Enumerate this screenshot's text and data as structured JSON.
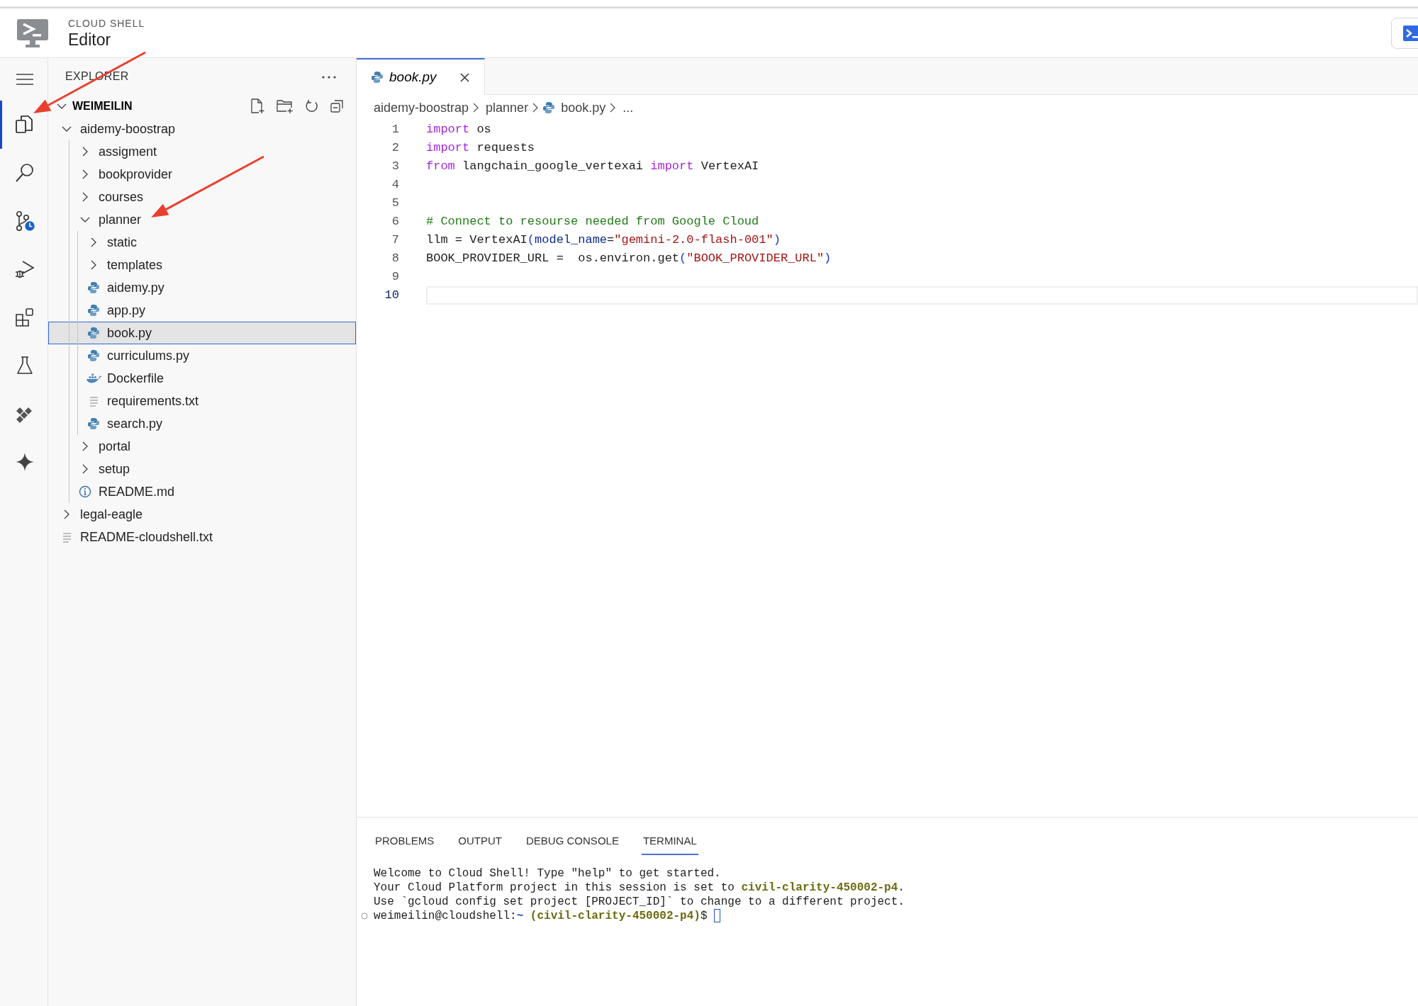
{
  "header": {
    "product": "CLOUD SHELL",
    "title": "Editor"
  },
  "activity_bar": [
    {
      "kind": "files",
      "selected": true
    },
    {
      "kind": "search",
      "selected": false
    },
    {
      "kind": "source-control",
      "selected": false
    },
    {
      "kind": "run-debug",
      "selected": false
    },
    {
      "kind": "extensions",
      "selected": false
    },
    {
      "kind": "testing",
      "selected": false
    },
    {
      "kind": "cloud-code",
      "selected": false
    },
    {
      "kind": "gemini",
      "selected": false
    }
  ],
  "explorer": {
    "title": "EXPLORER",
    "root": {
      "label": "WEIMEILIN",
      "expanded": true
    },
    "tree": [
      {
        "kind": "folder",
        "label": "aidemy-boostrap",
        "expanded": true,
        "selected": false,
        "children": [
          {
            "kind": "folder",
            "label": "assigment",
            "expanded": false,
            "selected": false
          },
          {
            "kind": "folder",
            "label": "bookprovider",
            "expanded": false,
            "selected": false
          },
          {
            "kind": "folder",
            "label": "courses",
            "expanded": false,
            "selected": false
          },
          {
            "kind": "folder",
            "label": "planner",
            "expanded": true,
            "selected": false,
            "children": [
              {
                "kind": "folder",
                "label": "static",
                "expanded": false,
                "selected": false
              },
              {
                "kind": "folder",
                "label": "templates",
                "expanded": false,
                "selected": false
              },
              {
                "kind": "python",
                "label": "aidemy.py",
                "selected": false
              },
              {
                "kind": "python",
                "label": "app.py",
                "selected": false
              },
              {
                "kind": "python",
                "label": "book.py",
                "selected": true
              },
              {
                "kind": "python",
                "label": "curriculums.py",
                "selected": false
              },
              {
                "kind": "docker",
                "label": "Dockerfile",
                "selected": false
              },
              {
                "kind": "text",
                "label": "requirements.txt",
                "selected": false
              },
              {
                "kind": "python",
                "label": "search.py",
                "selected": false
              }
            ]
          },
          {
            "kind": "folder",
            "label": "portal",
            "expanded": false,
            "selected": false
          },
          {
            "kind": "folder",
            "label": "setup",
            "expanded": false,
            "selected": false
          },
          {
            "kind": "info",
            "label": "README.md",
            "selected": false
          }
        ]
      },
      {
        "kind": "folder",
        "label": "legal-eagle",
        "expanded": false,
        "selected": false
      },
      {
        "kind": "text",
        "label": "README-cloudshell.txt",
        "selected": false
      }
    ]
  },
  "editor_tabs": [
    {
      "label": "book.py",
      "selected": true
    }
  ],
  "breadcrumbs": [
    {
      "kind": "folder",
      "label": "aidemy-boostrap"
    },
    {
      "kind": "folder",
      "label": "planner"
    },
    {
      "kind": "python",
      "label": "book.py"
    },
    {
      "kind": "more",
      "label": "..."
    }
  ],
  "code": [
    {
      "number": "1",
      "current": false,
      "tokens": [
        {
          "kind": "keyword",
          "text": "import"
        },
        {
          "kind": "plain",
          "text": " os"
        }
      ]
    },
    {
      "number": "2",
      "current": false,
      "tokens": [
        {
          "kind": "keyword",
          "text": "import"
        },
        {
          "kind": "plain",
          "text": " requests"
        }
      ]
    },
    {
      "number": "3",
      "current": false,
      "tokens": [
        {
          "kind": "keyword",
          "text": "from"
        },
        {
          "kind": "plain",
          "text": " langchain_google_vertexai "
        },
        {
          "kind": "keyword",
          "text": "import"
        },
        {
          "kind": "plain",
          "text": " VertexAI"
        }
      ]
    },
    {
      "number": "4",
      "current": false
    },
    {
      "number": "5",
      "current": false
    },
    {
      "number": "6",
      "current": false,
      "tokens": [
        {
          "kind": "comment",
          "text": "# Connect to resourse needed from Google Cloud"
        }
      ]
    },
    {
      "number": "7",
      "current": false,
      "tokens": [
        {
          "kind": "plain",
          "text": "llm = VertexAI"
        },
        {
          "kind": "bracket",
          "text": "("
        },
        {
          "kind": "param",
          "text": "model_name"
        },
        {
          "kind": "plain",
          "text": "="
        },
        {
          "kind": "string",
          "text": "\"gemini-2.0-flash-001\""
        },
        {
          "kind": "bracket",
          "text": ")"
        }
      ]
    },
    {
      "number": "8",
      "current": false,
      "tokens": [
        {
          "kind": "plain",
          "text": "BOOK_PROVIDER_URL =  os.environ.get"
        },
        {
          "kind": "bracket",
          "text": "("
        },
        {
          "kind": "string",
          "text": "\"BOOK_PROVIDER_URL\""
        },
        {
          "kind": "bracket",
          "text": ")"
        }
      ]
    },
    {
      "number": "9",
      "current": false
    },
    {
      "number": "10",
      "current": true
    }
  ],
  "panel_tabs": [
    {
      "label": "PROBLEMS",
      "selected": false
    },
    {
      "label": "OUTPUT",
      "selected": false
    },
    {
      "label": "DEBUG CONSOLE",
      "selected": false
    },
    {
      "label": "TERMINAL",
      "selected": true
    }
  ],
  "terminal": {
    "lines": [
      "Welcome to Cloud Shell! Type \"help\" to get started.",
      "Your Cloud Platform project in this session is set to **civil-clarity-450002-p4**.",
      "Use `gcloud config set project [PROJECT_ID]` to change to a different project."
    ],
    "prompt": [
      {
        "kind": "user",
        "text": "weimeilin@cloudshell:"
      },
      {
        "kind": "path",
        "text": "~"
      },
      {
        "kind": "project",
        "text": " (civil-clarity-450002-p4)"
      },
      {
        "kind": "user",
        "text": "$ "
      }
    ]
  },
  "annotations": [
    {
      "kind": "arrow",
      "color": "#e8402f"
    },
    {
      "kind": "arrow",
      "color": "#e8402f"
    }
  ]
}
